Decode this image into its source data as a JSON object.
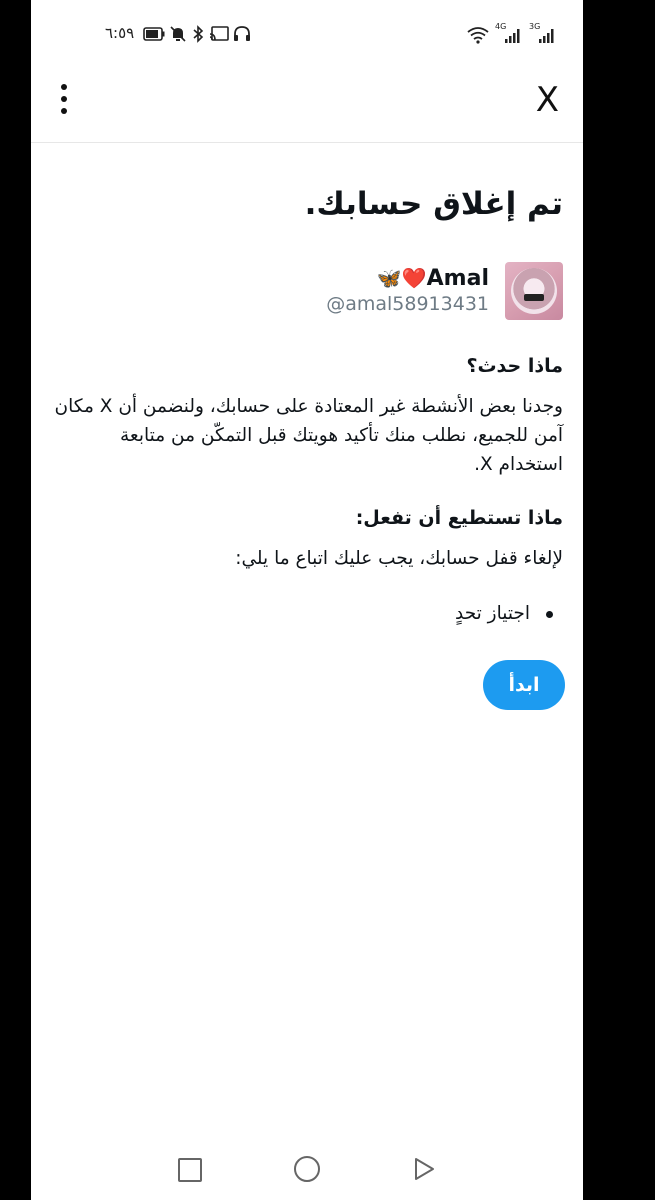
{
  "status": {
    "time": "٦:٥٩",
    "network_left": "4G",
    "network_right": "3G"
  },
  "topbar": {
    "menu_icon": "more-vertical-icon",
    "close_label": "X"
  },
  "page": {
    "title": "تم إغلاق حسابك.",
    "profile": {
      "display_name": "Amal",
      "emojis": "❤️🦋",
      "handle": "@amal58913431"
    },
    "section1": {
      "heading": "ماذا حدث؟",
      "body": "وجدنا بعض الأنشطة غير المعتادة على حسابك، ولنضمن أن X مكان آمن للجميع، نطلب منك تأكيد هويتك قبل التمكّن من متابعة استخدام X."
    },
    "section2": {
      "heading": "ماذا تستطيع أن تفعل:",
      "body": "لإلغاء قفل حسابك، يجب عليك اتباع ما يلي:",
      "bullets": [
        "اجتياز تحدٍ"
      ]
    },
    "start_button": "ابدأ"
  },
  "colors": {
    "accent": "#1d9bf0",
    "text": "#0f1419",
    "muted": "#6e7b85"
  }
}
